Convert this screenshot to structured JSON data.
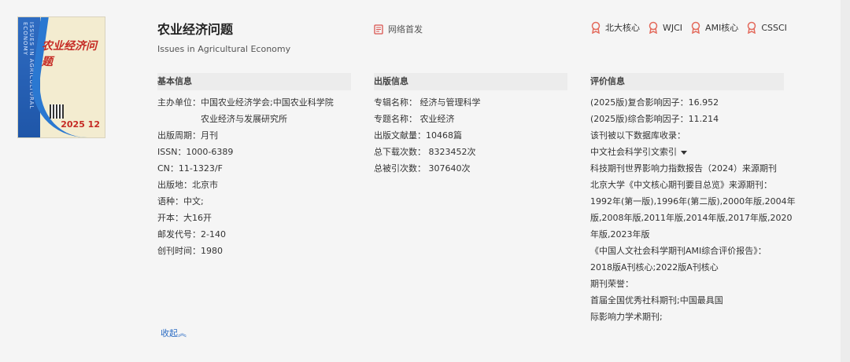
{
  "journal": {
    "title": "农业经济问题",
    "subtitle": "Issues in Agricultural Economy",
    "online_first": "网络首发",
    "cover_title": "农业经济问题",
    "cover_issue": "2025 12",
    "cover_en": "ISSUES IN AGRICULTURAL ECONOMY"
  },
  "badges": [
    "北大核心",
    "WJCI",
    "AMI核心",
    "CSSCI"
  ],
  "basic": {
    "heading": "基本信息",
    "lines": [
      "主办单位：中国农业经济学会;中国农业科学院",
      "农业经济与发展研究所",
      "出版周期：月刊",
      "ISSN：1000-6389",
      "CN：11-1323/F",
      "出版地：北京市",
      "语种：中文;",
      "开本：大16开",
      "邮发代号：2-140",
      "创刊时间：1980"
    ]
  },
  "publish": {
    "heading": "出版信息",
    "lines": [
      "专辑名称：  经济与管理科学",
      "专题名称：  农业经济",
      "出版文献量：10468篇",
      "总下载次数：  8323452次",
      "总被引次数：  307640次"
    ]
  },
  "evaluation": {
    "heading": "评价信息",
    "lines": [
      "(2025版)复合影响因子：16.952",
      "(2025版)综合影响因子：11.214",
      "该刊被以下数据库收录：",
      "中文社会科学引文索引",
      "科技期刊世界影响力指数报告（2024）来源期刊",
      "北京大学《中文核心期刊要目总览》来源期刊：",
      "1992年(第一版),1996年(第二版),2000年版,2004年",
      "版,2008年版,2011年版,2014年版,2017年版,2020",
      "年版,2023年版",
      "《中国人文社会科学期刊AMI综合评价报告》：",
      "2018版A刊核心;2022版A刊核心",
      "期刊荣誉：",
      "首届全国优秀社科期刊;中国最具国",
      "际影响力学术期刊;"
    ]
  },
  "collapse_label": "收起︽",
  "colors": {
    "link": "#2b6cc4",
    "badge": "#e36a5c",
    "online_icon": "#d9534f"
  }
}
